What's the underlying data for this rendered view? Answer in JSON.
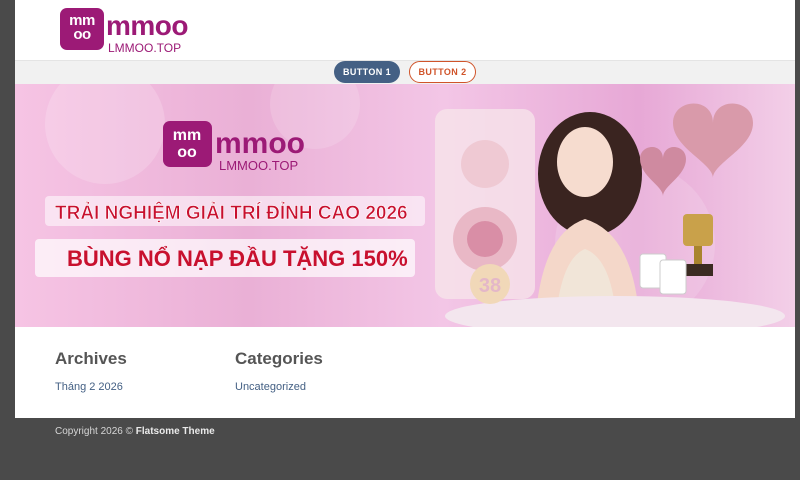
{
  "header": {
    "logo_mark": "mm oo",
    "logo_word": "mmoo",
    "logo_sub": "LMMOO.TOP"
  },
  "nav": {
    "button1": "BUTTON 1",
    "button2": "BUTTON 2"
  },
  "banner": {
    "logo_word": "mmoo",
    "logo_sub": "LMMOO.TOP",
    "headline": "TRẢI NGHIỆM GIẢI TRÍ ĐỈNH CAO 2026",
    "promo": "BÙNG NỔ NẠP ĐẦU TẶNG 150%",
    "badge": "38"
  },
  "widgets": {
    "archives_title": "Archives",
    "archives_link": "Tháng 2 2026",
    "categories_title": "Categories",
    "categories_link": "Uncategorized"
  },
  "footer": {
    "copyright_prefix": "Copyright 2026 ©",
    "theme_name": "Flatsome Theme"
  },
  "colors": {
    "brand": "#9c1a76",
    "button1": "#446084",
    "button2": "#d0542a",
    "footer_bg": "#4a4a4a"
  }
}
